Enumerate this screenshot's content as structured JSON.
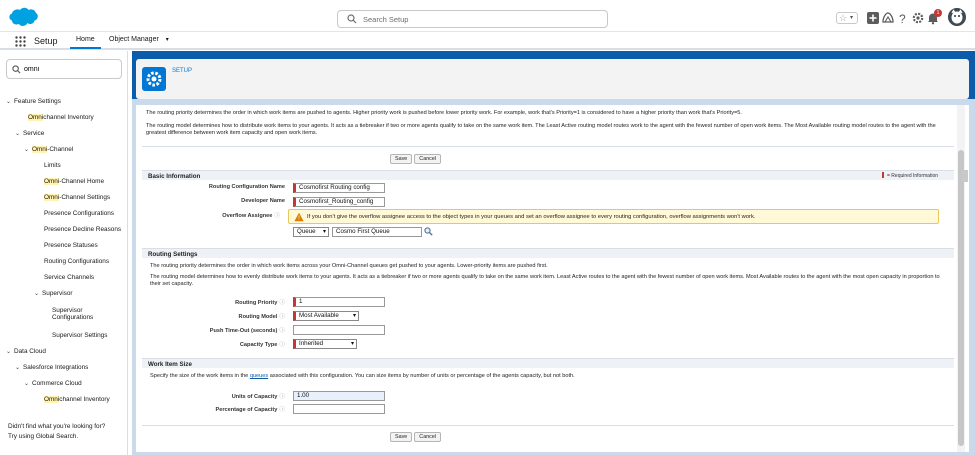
{
  "header": {
    "search_placeholder": "Search Setup",
    "notification_count": "1"
  },
  "nav": {
    "app_name": "Setup",
    "tabs": [
      {
        "label": "Home"
      },
      {
        "label": "Object Manager"
      }
    ]
  },
  "sidebar": {
    "quick_find_value": "omni",
    "items": [
      {
        "label": "Feature Settings",
        "highlight": ""
      },
      {
        "label": "channel Inventory",
        "highlight": "Omni"
      },
      {
        "label": "Service",
        "highlight": ""
      },
      {
        "label": "-Channel",
        "highlight": "Omni"
      },
      {
        "label": "Limits",
        "highlight": ""
      },
      {
        "label": "-Channel Home",
        "highlight": "Omni"
      },
      {
        "label": "-Channel Settings",
        "highlight": "Omni"
      },
      {
        "label": "Presence Configurations",
        "highlight": ""
      },
      {
        "label": "Presence Decline Reasons",
        "highlight": ""
      },
      {
        "label": "Presence Statuses",
        "highlight": ""
      },
      {
        "label": "Routing Configurations",
        "highlight": ""
      },
      {
        "label": "Service Channels",
        "highlight": ""
      },
      {
        "label": "Supervisor",
        "highlight": ""
      },
      {
        "label": "Supervisor",
        "highlight": ""
      },
      {
        "label": "Configurations",
        "highlight": ""
      },
      {
        "label": "Supervisor Settings",
        "highlight": ""
      },
      {
        "label": "Data Cloud",
        "highlight": ""
      },
      {
        "label": "Salesforce Integrations",
        "highlight": ""
      },
      {
        "label": "Commerce Cloud",
        "highlight": ""
      },
      {
        "label": "channel Inventory",
        "highlight": "Omni"
      }
    ],
    "footer_line1": "Didn't find what you're looking for?",
    "footer_line2": "Try using Global Search."
  },
  "page": {
    "breadcrumb": "SETUP",
    "intro_p1": "The routing priority determines the order in which work items are pushed to agents. Higher priority work is pushed before lower priority work. For example, work that's Priority=1 is considered to have a higher priority than work that's Priority=5.",
    "intro_p2": "The routing model determines how to distribute work items to your agents. It acts as a tiebreaker if two or more agents qualify to take on the same work item. The Least Active routing model routes work to the agent with the fewest number of open work items. The Most Available routing model routes to the agent with the greatest difference between work item capacity and open work items.",
    "save_label": "Save",
    "cancel_label": "Cancel",
    "required_legend": "= Required Information",
    "basic_info": {
      "title": "Basic Information",
      "routing_config_name_label": "Routing Configuration Name",
      "routing_config_name_value": "Cosmofirst Routing config",
      "developer_name_label": "Developer Name",
      "developer_name_value": "Cosmofirst_Routing_config",
      "overflow_label": "Overflow Assignee",
      "overflow_warning": "If you don't give the overflow assignee access to the object types in your queues and set an overflow assignee to every routing configuration, overflow assignments won't work.",
      "overflow_type": "Queue",
      "overflow_value": "Cosmo First Queue"
    },
    "routing_settings": {
      "title": "Routing Settings",
      "p1": "The routing priority determines the order in which work items across your Omni-Channel queues get pushed to your agents. Lower-priority items are pushed first.",
      "p2": "The routing model determines how to evenly distribute work items to your agents. It acts as a tiebreaker if two or more agents qualify to take on the same work item. Least Active routes to the agent with the fewest number of open work items. Most Available routes to the agent with the most open capacity in proportion to their set capacity.",
      "priority_label": "Routing Priority",
      "priority_value": "1",
      "model_label": "Routing Model",
      "model_value": "Most Available",
      "push_timeout_label": "Push Time-Out (seconds)",
      "push_timeout_value": "",
      "capacity_type_label": "Capacity Type",
      "capacity_type_value": "Inherited"
    },
    "work_item_size": {
      "title": "Work Item Size",
      "text_before": "Specify the size of the work items in the ",
      "text_link": "queues",
      "text_after": " associated with this configuration. You can size items by number of units or percentage of the agents capacity, but not both.",
      "units_label": "Units of Capacity",
      "units_value": "1.00",
      "percentage_label": "Percentage of Capacity",
      "percentage_value": ""
    }
  },
  "colors": {
    "brand": "#0176d3",
    "required": "#c23934",
    "header_band": "#0b5cab"
  }
}
